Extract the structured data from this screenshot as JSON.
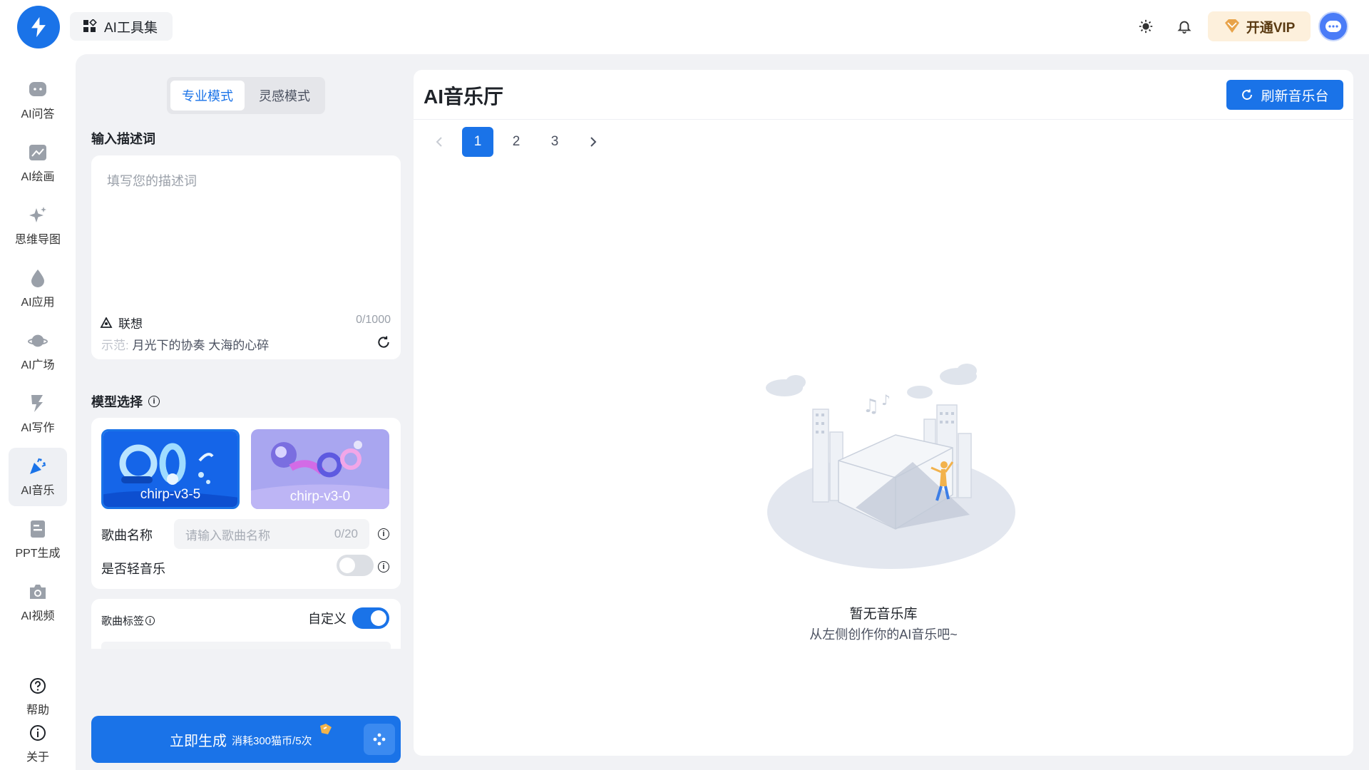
{
  "topbar": {
    "toolset_label": "AI工具集",
    "vip_label": "开通VIP"
  },
  "nav": {
    "items": [
      {
        "label": "AI问答",
        "icon": "chat-bubble-icon"
      },
      {
        "label": "AI绘画",
        "icon": "image-icon"
      },
      {
        "label": "思维导图",
        "icon": "sparkle-icon"
      },
      {
        "label": "AI应用",
        "icon": "drop-icon"
      },
      {
        "label": "AI广场",
        "icon": "planet-icon"
      },
      {
        "label": "AI写作",
        "icon": "pen-icon"
      },
      {
        "label": "AI音乐",
        "icon": "party-popper-icon"
      },
      {
        "label": "PPT生成",
        "icon": "document-icon"
      },
      {
        "label": "AI视频",
        "icon": "camera-icon"
      }
    ],
    "active_index": 6,
    "help_label": "帮助",
    "about_label": "关于"
  },
  "left": {
    "modes": [
      "专业模式",
      "灵感模式"
    ],
    "active_mode": "专业模式",
    "prompt_section": "输入描述词",
    "prompt_placeholder": "填写您的描述词",
    "assoc_label": "联想",
    "counter": "0/1000",
    "example_prefix": "示范:",
    "example_text": "月光下的协奏 大海的心碎",
    "model_section": "模型选择",
    "models": [
      {
        "name": "chirp-v3-5",
        "selected": true
      },
      {
        "name": "chirp-v3-0",
        "selected": false
      }
    ],
    "song_name_label": "歌曲名称",
    "song_name_placeholder": "请输入歌曲名称",
    "song_name_counter": "0/20",
    "light_music_label": "是否轻音乐",
    "light_music_on": false,
    "tags_label": "歌曲标签",
    "custom_label": "自定义",
    "custom_on": true,
    "generate_label": "立即生成",
    "generate_cost": "消耗300猫币/5次"
  },
  "right": {
    "title": "AI音乐厅",
    "refresh_label": "刷新音乐台",
    "pages": [
      "1",
      "2",
      "3"
    ],
    "current_page": "1",
    "empty_title": "暂无音乐库",
    "empty_sub": "从左侧创作你的AI音乐吧~"
  },
  "colors": {
    "accent": "#1a73e8",
    "workspace_bg": "#f1f2f5",
    "vip_bg": "#fdf0dc"
  }
}
